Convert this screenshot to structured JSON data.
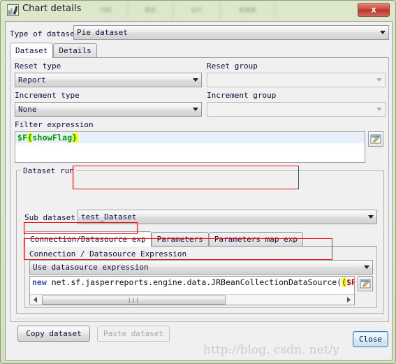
{
  "window": {
    "title": "Chart details",
    "icon": "chart-details-icon",
    "close_label": "x",
    "background_tabs": [
      "代码",
      "预览",
      "设计",
      "数据源"
    ]
  },
  "form": {
    "type_of_dataset_label": "Type of dataset",
    "type_of_dataset_value": "Pie dataset",
    "tabs": [
      {
        "label": "Dataset",
        "active": true
      },
      {
        "label": "Details",
        "active": false
      }
    ],
    "reset_type_label": "Reset type",
    "reset_type_value": "Report",
    "reset_group_label": "Reset group",
    "reset_group_value": "",
    "increment_type_label": "Increment type",
    "increment_type_value": "None",
    "increment_group_label": "Increment group",
    "increment_group_value": "",
    "filter_expression_label": "Filter expression",
    "filter_expression": {
      "prefix": "$F",
      "open_brace": "{",
      "name": "showFlag",
      "close_brace": "}"
    },
    "filter_edit_button": "expression-editor-icon"
  },
  "dataset_run": {
    "group_title": "Dataset run",
    "sub_dataset_label": "Sub dataset",
    "sub_dataset_value": "test_Dataset",
    "tabs": [
      {
        "label": "Connection/Datasource exp",
        "active": true
      },
      {
        "label": "Parameters",
        "active": false
      },
      {
        "label": "Parameters map exp",
        "active": false
      }
    ],
    "connection_expression_label": "Connection / Datasource Expression",
    "connection_mode_value": "Use datasource expression",
    "expression": {
      "keyword": "new",
      "body": " net.sf.jasperreports.engine.data.JRBeanCollectionDataSource(",
      "param_token": "$P {",
      "highlight_char": "("
    },
    "expression_edit_button": "expression-editor-icon",
    "scrollbar": {
      "left_arrow": "scroll-left-arrow",
      "right_arrow": "scroll-right-arrow",
      "grip": "|||"
    }
  },
  "footer": {
    "copy_label": "Copy dataset",
    "paste_label": "Paste dataset",
    "close_label": "Close"
  },
  "watermark": "http://blog. csdn. net/y",
  "colors": {
    "window_frame": "#dce7cb",
    "close_red": "#cf4f42",
    "annotation_red": "#ee1111",
    "highlight_yellow": "#ffff00",
    "expression_green": "#009900",
    "keyword_blue": "#3b4ecc",
    "param_red": "#d40000",
    "selected_line": "#e8f0fa"
  }
}
